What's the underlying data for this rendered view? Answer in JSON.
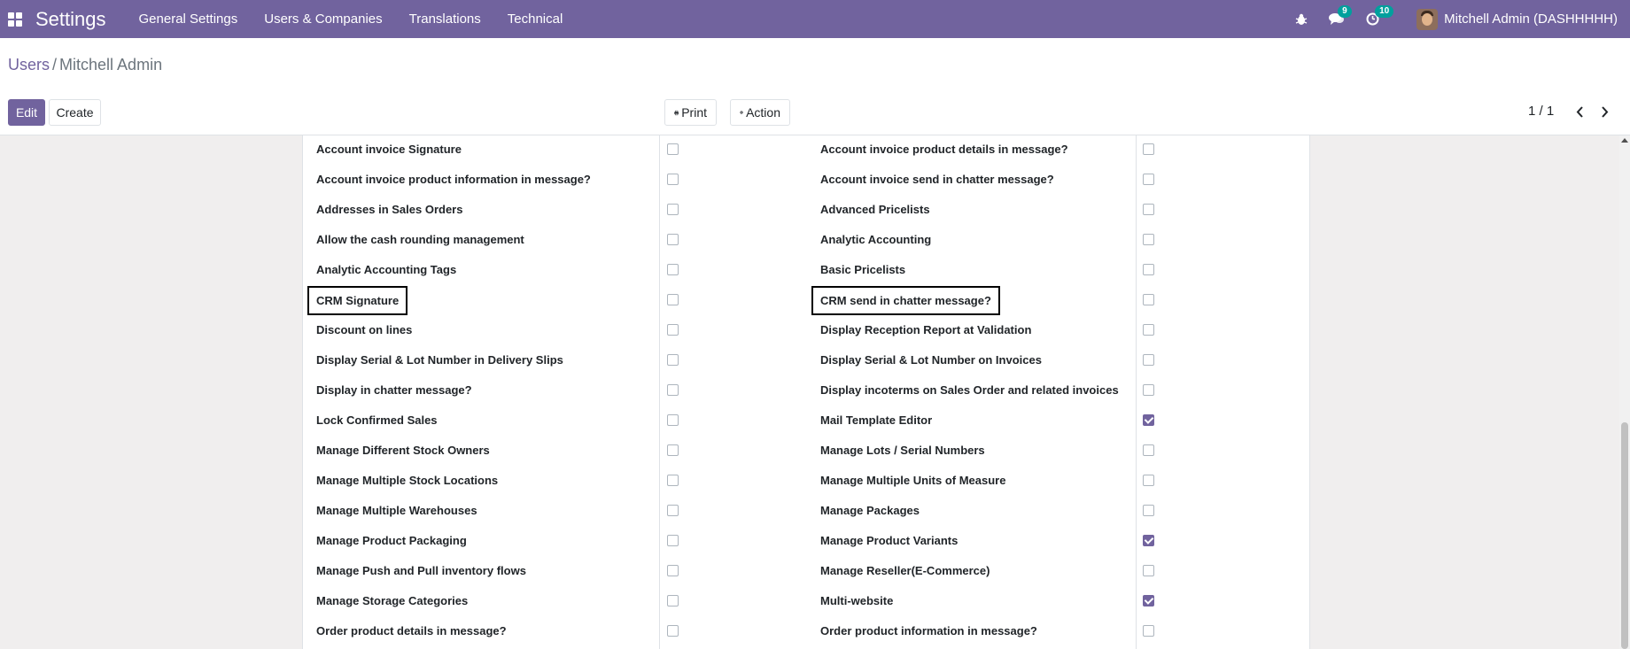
{
  "navbar": {
    "app_title": "Settings",
    "menu": [
      "General Settings",
      "Users & Companies",
      "Translations",
      "Technical"
    ],
    "messages_count": "9",
    "activities_count": "10",
    "user_name": "Mitchell Admin (DASHHHHH)"
  },
  "breadcrumb": {
    "parent": "Users",
    "separator": "/",
    "current": "Mitchell Admin"
  },
  "buttons": {
    "edit": "Edit",
    "create": "Create",
    "print": "Print",
    "action": "Action"
  },
  "pager": {
    "value": "1 / 1"
  },
  "colors": {
    "brand": "#71639e",
    "badge": "#00a09d"
  },
  "rows": [
    {
      "left": {
        "label": "Account invoice Signature",
        "checked": false
      },
      "right": {
        "label": "Account invoice product details in message?",
        "checked": false
      }
    },
    {
      "left": {
        "label": "Account invoice product information in message?",
        "checked": false
      },
      "right": {
        "label": "Account invoice send in chatter message?",
        "checked": false
      }
    },
    {
      "left": {
        "label": "Addresses in Sales Orders",
        "checked": false
      },
      "right": {
        "label": "Advanced Pricelists",
        "checked": false
      }
    },
    {
      "left": {
        "label": "Allow the cash rounding management",
        "checked": false
      },
      "right": {
        "label": "Analytic Accounting",
        "checked": false
      }
    },
    {
      "left": {
        "label": "Analytic Accounting Tags",
        "checked": false
      },
      "right": {
        "label": "Basic Pricelists",
        "checked": false
      }
    },
    {
      "left": {
        "label": "CRM Signature",
        "checked": false,
        "highlighted": true
      },
      "right": {
        "label": "CRM send in chatter message?",
        "checked": false,
        "highlighted": true
      }
    },
    {
      "left": {
        "label": "Discount on lines",
        "checked": false
      },
      "right": {
        "label": "Display Reception Report at Validation",
        "checked": false
      }
    },
    {
      "left": {
        "label": "Display Serial & Lot Number in Delivery Slips",
        "checked": false
      },
      "right": {
        "label": "Display Serial & Lot Number on Invoices",
        "checked": false
      }
    },
    {
      "left": {
        "label": "Display in chatter message?",
        "checked": false
      },
      "right": {
        "label": "Display incoterms on Sales Order and related invoices",
        "checked": false
      }
    },
    {
      "left": {
        "label": "Lock Confirmed Sales",
        "checked": false
      },
      "right": {
        "label": "Mail Template Editor",
        "checked": true
      }
    },
    {
      "left": {
        "label": "Manage Different Stock Owners",
        "checked": false
      },
      "right": {
        "label": "Manage Lots / Serial Numbers",
        "checked": false
      }
    },
    {
      "left": {
        "label": "Manage Multiple Stock Locations",
        "checked": false
      },
      "right": {
        "label": "Manage Multiple Units of Measure",
        "checked": false
      }
    },
    {
      "left": {
        "label": "Manage Multiple Warehouses",
        "checked": false
      },
      "right": {
        "label": "Manage Packages",
        "checked": false
      }
    },
    {
      "left": {
        "label": "Manage Product Packaging",
        "checked": false
      },
      "right": {
        "label": "Manage Product Variants",
        "checked": true
      }
    },
    {
      "left": {
        "label": "Manage Push and Pull inventory flows",
        "checked": false
      },
      "right": {
        "label": "Manage Reseller(E-Commerce)",
        "checked": false
      }
    },
    {
      "left": {
        "label": "Manage Storage Categories",
        "checked": false
      },
      "right": {
        "label": "Multi-website",
        "checked": true
      }
    },
    {
      "left": {
        "label": "Order product details in message?",
        "checked": false
      },
      "right": {
        "label": "Order product information in message?",
        "checked": false
      }
    }
  ]
}
